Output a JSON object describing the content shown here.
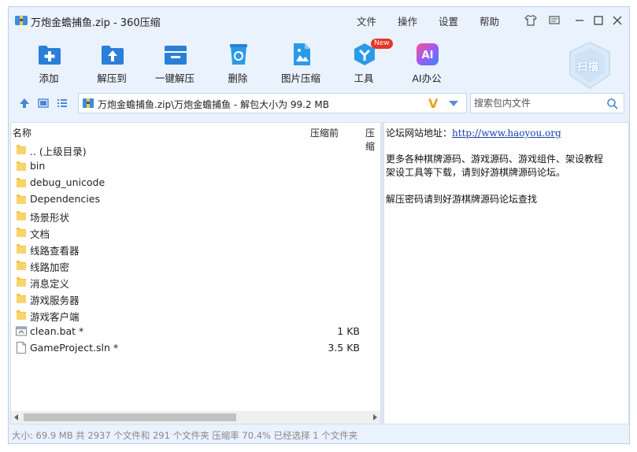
{
  "window": {
    "title": "万炮金蟾捕鱼.zip - 360压缩",
    "menu": [
      "文件",
      "操作",
      "设置",
      "帮助"
    ]
  },
  "toolbar": {
    "items": [
      {
        "label": "添加",
        "icon": "add-icon"
      },
      {
        "label": "解压到",
        "icon": "extract-to-icon"
      },
      {
        "label": "一键解压",
        "icon": "one-click-extract-icon"
      },
      {
        "label": "删除",
        "icon": "recycle-icon"
      },
      {
        "label": "图片压缩",
        "icon": "image-compress-icon"
      },
      {
        "label": "工具",
        "icon": "tools-icon",
        "badge": "New"
      },
      {
        "label": "AI办公",
        "icon": "ai-icon",
        "icon_text": "AI"
      }
    ],
    "scan_label": "扫描"
  },
  "address": {
    "path": "万炮金蟾捕鱼.zip\\万炮金蟾捕鱼 - 解包大小为 99.2 MB",
    "v_mark": "V"
  },
  "search": {
    "placeholder": "搜索包内文件"
  },
  "filelist": {
    "columns": {
      "name": "名称",
      "before": "压缩前",
      "after": "压缩"
    },
    "rows": [
      {
        "name": ".. (上级目录)",
        "size": "",
        "type": "folder"
      },
      {
        "name": "bin",
        "size": "",
        "type": "folder"
      },
      {
        "name": "debug_unicode",
        "size": "",
        "type": "folder"
      },
      {
        "name": "Dependencies",
        "size": "",
        "type": "folder"
      },
      {
        "name": "场景形状",
        "size": "",
        "type": "folder"
      },
      {
        "name": "文档",
        "size": "",
        "type": "folder"
      },
      {
        "name": "线路查看器",
        "size": "",
        "type": "folder"
      },
      {
        "name": "线路加密",
        "size": "",
        "type": "folder"
      },
      {
        "name": "消息定义",
        "size": "",
        "type": "folder"
      },
      {
        "name": "游戏服务器",
        "size": "",
        "type": "folder"
      },
      {
        "name": "游戏客户端",
        "size": "",
        "type": "folder"
      },
      {
        "name": "clean.bat *",
        "size": "1 KB",
        "type": "bat"
      },
      {
        "name": "GameProject.sln *",
        "size": "3.5 KB",
        "type": "file"
      }
    ]
  },
  "comment": {
    "line1_label": "论坛网站地址：",
    "line1_link": "http://www.haoyou.org",
    "line2": "更多各种棋牌源码、游戏源码、游戏组件、架设教程",
    "line3": "架设工具等下载，请到好游棋牌源码论坛。",
    "line4": "解压密码请到好游棋牌源码论坛查找"
  },
  "status": {
    "text": "大小: 69.9 MB 共 2937 个文件和 291 个文件夹 压缩率 70.4% 已经选择 1 个文件夹"
  },
  "colors": {
    "accent": "#2b7fd8",
    "window_bg": "#e9f2fd",
    "folder": "#f5c64a",
    "badge": "#e8342b"
  }
}
